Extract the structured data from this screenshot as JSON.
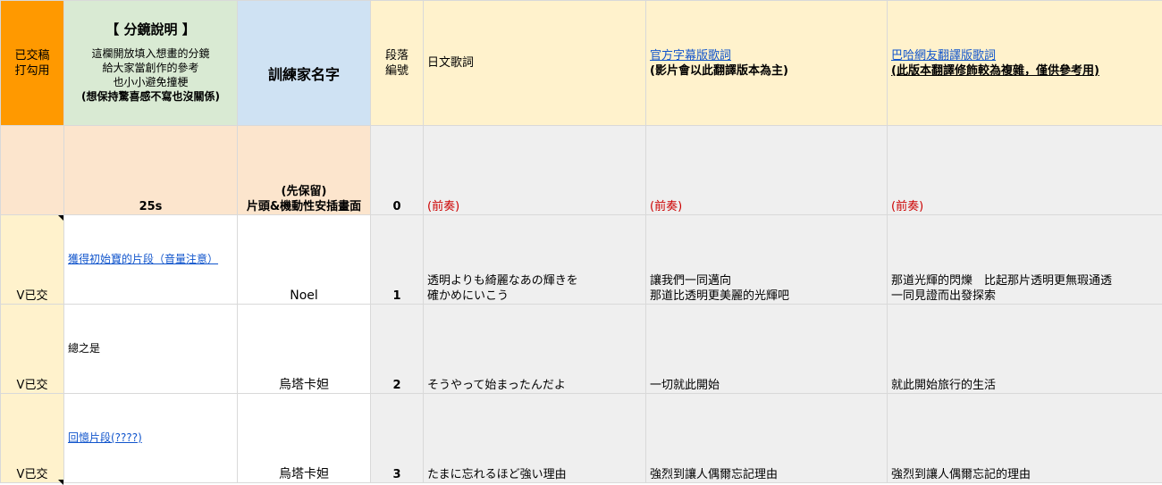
{
  "header": {
    "submitted": [
      "已交稿",
      "打勾用"
    ],
    "storyboard_title": "【 分鏡說明 】",
    "storyboard_note": [
      "這欄開放填入想畫的分鏡",
      "給大家當創作的參考",
      "也小小避免撞梗",
      "(想保持驚喜感不寫也沒關係)"
    ],
    "trainer": "訓練家名字",
    "segment": [
      "段落",
      "編號"
    ],
    "japanese": "日文歌詞",
    "official_title": "官方字幕版歌詞",
    "official_note": "(影片會以此翻譯版本為主)",
    "bahamut_title": "巴哈網友翻譯版歌詞",
    "bahamut_note": "(此版本翻譯修飾較為複雜，僅供參考用)"
  },
  "intro_row": {
    "submitted": "",
    "storyboard": "25s",
    "trainer": [
      "(先保留)",
      "片頭&機動性安插畫面"
    ],
    "segment": "0",
    "japanese": "(前奏)",
    "official": "(前奏)",
    "bahamut": "(前奏)"
  },
  "rows": [
    {
      "submitted": "V已交",
      "storyboard": "獲得初始寶的片段（音量注意）",
      "storyboard_link": true,
      "trainer": "Noel",
      "segment": "1",
      "japanese": [
        "透明よりも綺麗なあの輝きを",
        "確かめにいこう"
      ],
      "official": [
        "讓我們一同邁向",
        "那道比透明更美麗的光輝吧"
      ],
      "bahamut": [
        "那道光輝的閃爍　比起那片透明更無瑕通透",
        "一同見證而出發探索"
      ]
    },
    {
      "submitted": "V已交",
      "storyboard": "總之是",
      "storyboard_link": false,
      "trainer": "烏塔卡妲",
      "segment": "2",
      "japanese": [
        "そうやって始まったんだよ"
      ],
      "official": [
        "一切就此開始"
      ],
      "bahamut": [
        "就此開始旅行的生活"
      ]
    },
    {
      "submitted": "V已交",
      "storyboard": "回憶片段(????)",
      "storyboard_link": true,
      "trainer": "烏塔卡妲",
      "segment": "3",
      "japanese": [
        "たまに忘れるほど強い理由"
      ],
      "official": [
        "強烈到讓人偶爾忘記理由"
      ],
      "bahamut": [
        "強烈到讓人偶爾忘記的理由"
      ]
    }
  ],
  "colors": {
    "submitted_header": "#ff9900",
    "storyboard_header": "#d9ead3",
    "trainer_header": "#cfe2f3",
    "cream": "#fff2cc",
    "peach": "#fce5cd",
    "gray": "#efefef",
    "link": "#1155cc",
    "red": "#cc0000"
  }
}
